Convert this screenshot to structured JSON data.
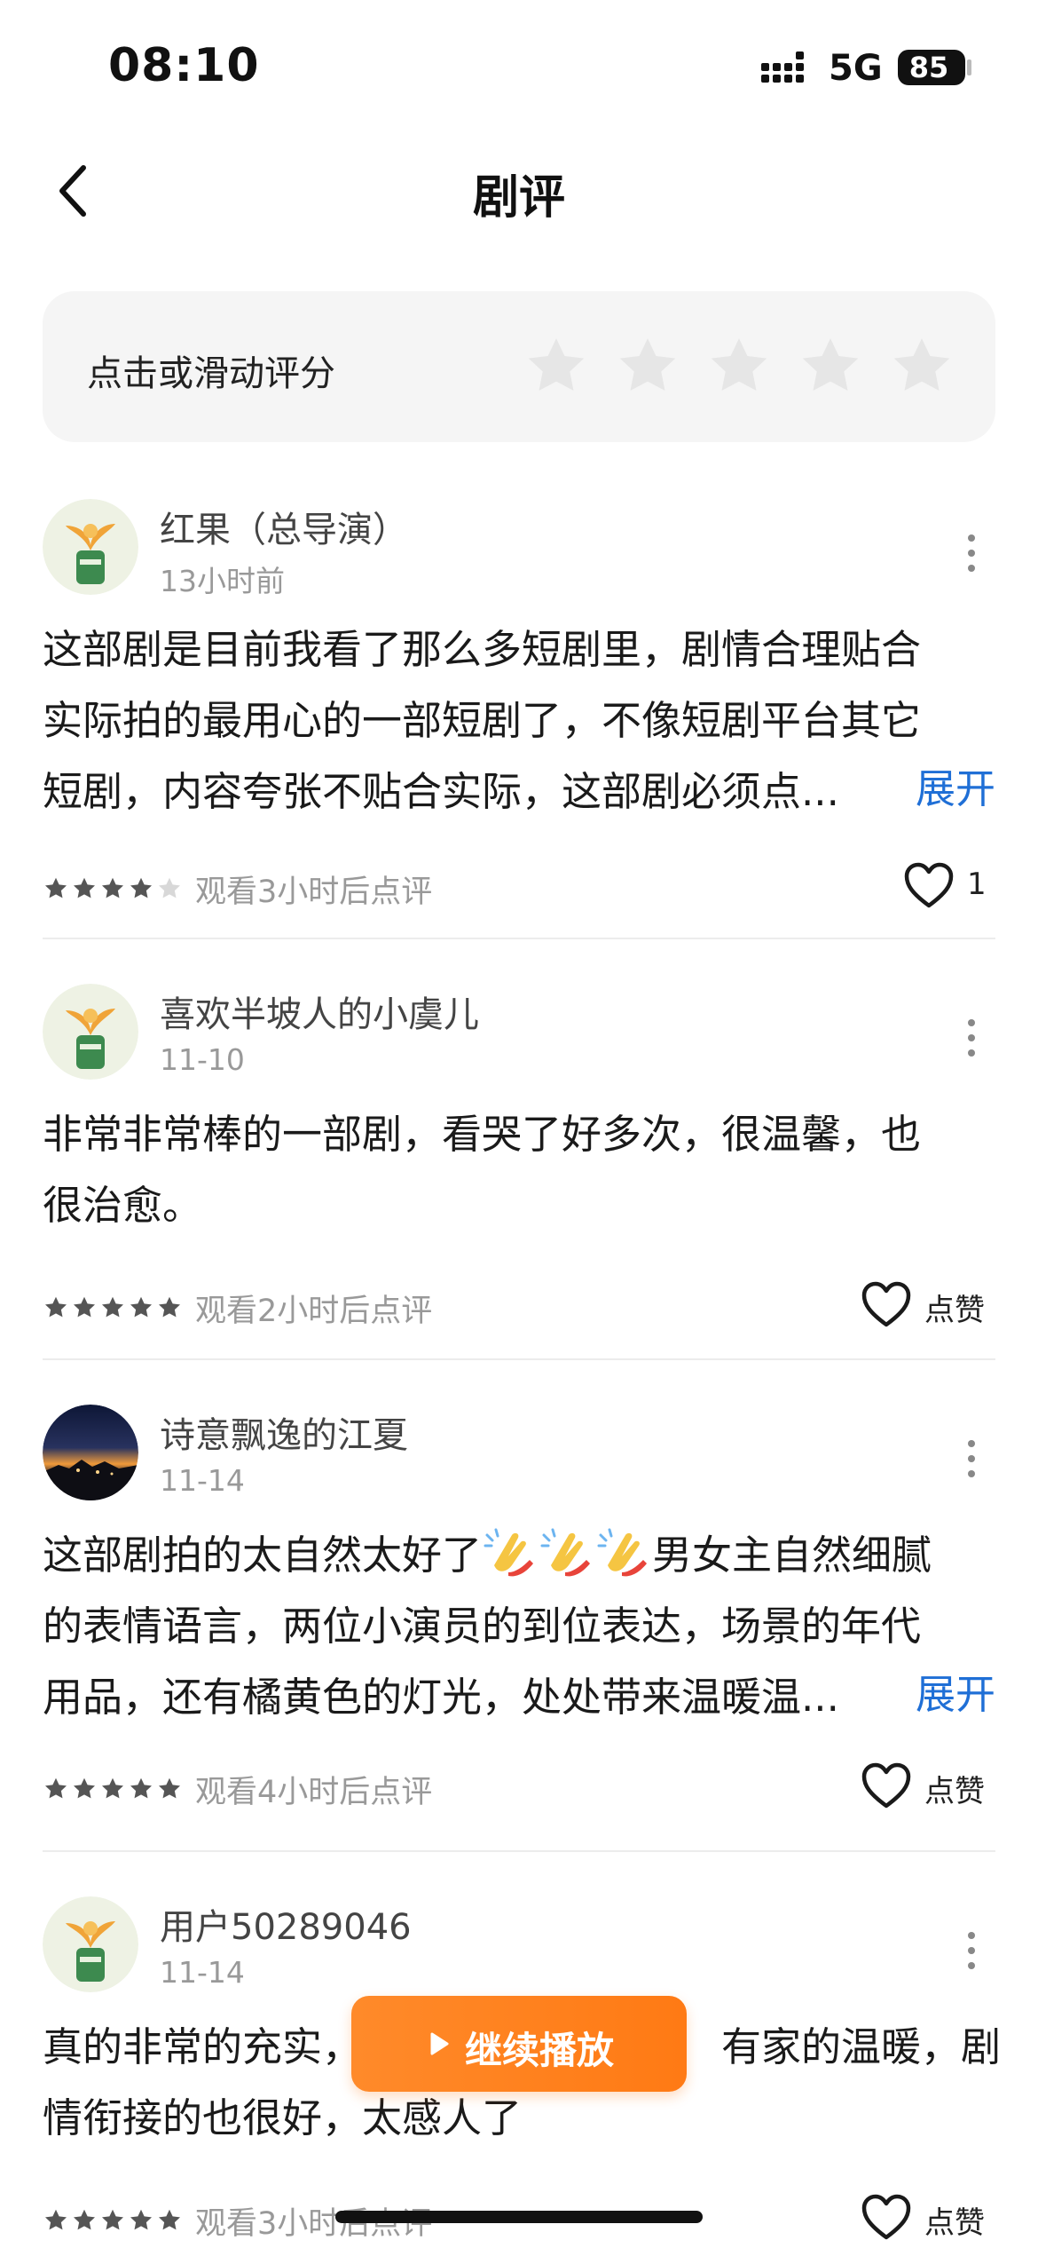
{
  "status_bar": {
    "time": "08:10",
    "network": "5G",
    "battery": "85"
  },
  "header": {
    "title": "剧评",
    "back_icon": "chevron-left-icon"
  },
  "rating": {
    "prompt": "点击或滑动评分",
    "max_stars": 5,
    "current": 0,
    "star_color": "#e6e6e6"
  },
  "reviews": [
    {
      "user": "红果（总导演）",
      "time": "13小时前",
      "avatar": "leaf-illustration",
      "lines": [
        "这部剧是目前我看了那么多短剧里，剧情合理贴合",
        "实际拍的最用心的一部短剧了，不像短剧平台其它",
        "短剧，内容夸张不贴合实际，这部剧必须点..."
      ],
      "expand": "展开",
      "stars": 4.5,
      "note": "观看3小时后点评",
      "likes": "1"
    },
    {
      "user": "喜欢半坡人的小虞儿",
      "time": "11-10",
      "avatar": "leaf-illustration",
      "lines": [
        "非常非常棒的一部剧，看哭了好多次，很温馨，也",
        "很治愈。"
      ],
      "stars": 5,
      "note": "观看2小时后点评",
      "likes": "点赞"
    },
    {
      "user": "诗意飘逸的江夏",
      "time": "11-14",
      "avatar": "sunset-photo",
      "line1_before": "这部剧拍的太自然太好了",
      "line1_after": "男女主自然细腻",
      "emoji": "clapping-hands-icon",
      "lines": [
        "的表情语言，两位小演员的到位表达，场景的年代",
        "用品，还有橘黄色的灯光，处处带来温暖温..."
      ],
      "expand": "展开",
      "stars": 5,
      "note": "观看4小时后点评",
      "likes": "点赞"
    },
    {
      "user": "用户50289046",
      "time": "11-14",
      "avatar": "leaf-illustration",
      "line1_start": "真的非常的充实，",
      "line1_end": "有家的温暖，剧",
      "lines": [
        "情衔接的也很好，太感人了"
      ],
      "stars": 5,
      "note": "观看3小时后点评",
      "likes": "点赞"
    }
  ],
  "continue_button": {
    "label": "继续播放",
    "color": "#ff7f1e"
  },
  "colors": {
    "accent_link": "#1f6fd6",
    "muted": "#999999"
  }
}
